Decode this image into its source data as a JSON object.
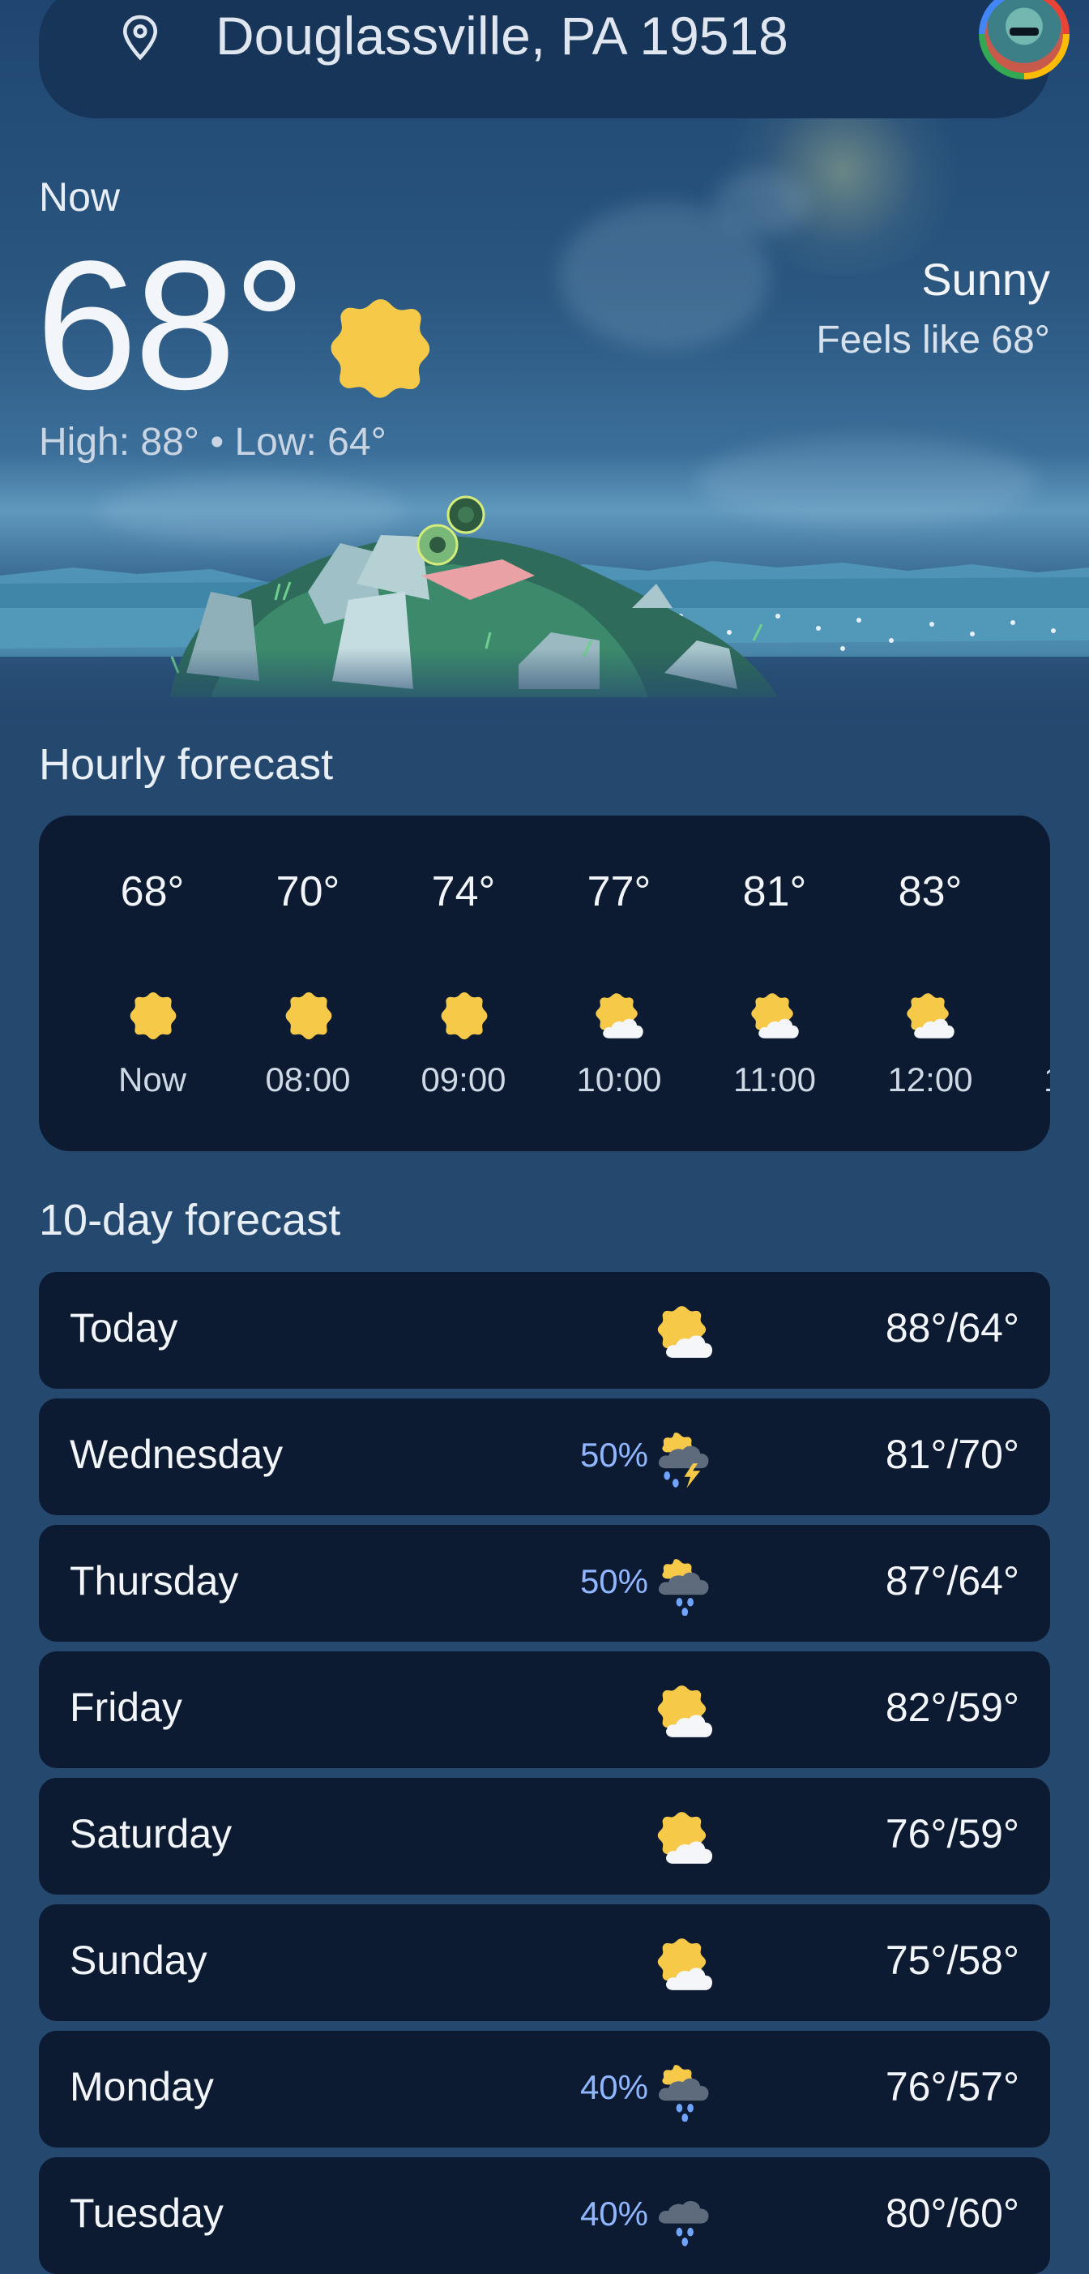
{
  "search": {
    "location": "Douglassville, PA 19518"
  },
  "current": {
    "label": "Now",
    "temp": "68°",
    "condition": "Sunny",
    "feels_like": "Feels like 68°",
    "high_low": "High: 88° • Low: 64°",
    "icon": "sun-icon"
  },
  "hourly": {
    "title": "Hourly forecast",
    "items": [
      {
        "temp": "68°",
        "time": "Now",
        "icon": "sun-icon"
      },
      {
        "temp": "70°",
        "time": "08:00",
        "icon": "sun-icon"
      },
      {
        "temp": "74°",
        "time": "09:00",
        "icon": "sun-icon"
      },
      {
        "temp": "77°",
        "time": "10:00",
        "icon": "partly-cloudy-icon"
      },
      {
        "temp": "81°",
        "time": "11:00",
        "icon": "partly-cloudy-icon"
      },
      {
        "temp": "83°",
        "time": "12:00",
        "icon": "partly-cloudy-icon"
      }
    ],
    "next_peek": "1"
  },
  "daily": {
    "title": "10-day forecast",
    "items": [
      {
        "day": "Today",
        "precip": "",
        "temps": "88°/64°",
        "icon": "partly-cloudy-icon"
      },
      {
        "day": "Wednesday",
        "precip": "50%",
        "temps": "81°/70°",
        "icon": "thunderstorm-icon"
      },
      {
        "day": "Thursday",
        "precip": "50%",
        "temps": "87°/64°",
        "icon": "rain-showers-icon"
      },
      {
        "day": "Friday",
        "precip": "",
        "temps": "82°/59°",
        "icon": "partly-cloudy-icon"
      },
      {
        "day": "Saturday",
        "precip": "",
        "temps": "76°/59°",
        "icon": "partly-cloudy-icon"
      },
      {
        "day": "Sunday",
        "precip": "",
        "temps": "75°/58°",
        "icon": "partly-cloudy-icon"
      },
      {
        "day": "Monday",
        "precip": "40%",
        "temps": "76°/57°",
        "icon": "rain-showers-icon"
      },
      {
        "day": "Tuesday",
        "precip": "40%",
        "temps": "80°/60°",
        "icon": "rain-icon"
      }
    ]
  },
  "colors": {
    "background": "#25486f",
    "card": "#0c1b31",
    "sun": "#f7c948",
    "precip": "#8fb6ff"
  }
}
